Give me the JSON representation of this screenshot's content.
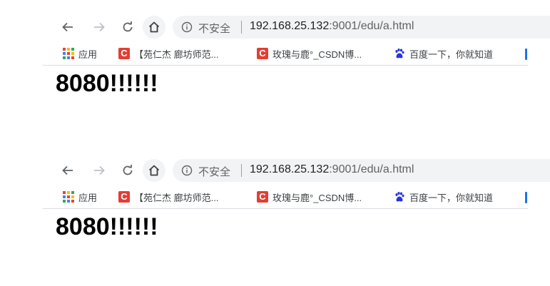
{
  "windows": [
    {
      "omnibox": {
        "security_label": "不安全",
        "url_host": "192.168.25.132",
        "url_port": ":9001",
        "url_path": "/edu/a.html"
      },
      "bookmarks": [
        {
          "label": "应用",
          "icon": "apps-grid-icon"
        },
        {
          "label": "【苑仁杰 廊坊师范...",
          "icon": "csdn-icon"
        },
        {
          "label": "玫瑰与鹿°_CSDN博...",
          "icon": "csdn-icon"
        },
        {
          "label": "百度一下，你就知道",
          "icon": "baidu-paw-icon"
        }
      ],
      "page": {
        "heading": "8080!!!!!!"
      }
    },
    {
      "omnibox": {
        "security_label": "不安全",
        "url_host": "192.168.25.132",
        "url_port": ":9001",
        "url_path": "/edu/a.html"
      },
      "bookmarks": [
        {
          "label": "应用",
          "icon": "apps-grid-icon"
        },
        {
          "label": "【苑仁杰 廊坊师范...",
          "icon": "csdn-icon"
        },
        {
          "label": "玫瑰与鹿°_CSDN博...",
          "icon": "csdn-icon"
        },
        {
          "label": "百度一下，你就知道",
          "icon": "baidu-paw-icon"
        }
      ],
      "page": {
        "heading": "8080!!!!!!"
      }
    }
  ],
  "colors": {
    "csdn_red": "#e33e33",
    "baidu_blue": "#2932e1",
    "apps_colors": [
      "#ea4335",
      "#fbbc04",
      "#34a853",
      "#4285f4",
      "#ea4335",
      "#fbbc04",
      "#34a853",
      "#4285f4",
      "#ea4335"
    ]
  }
}
